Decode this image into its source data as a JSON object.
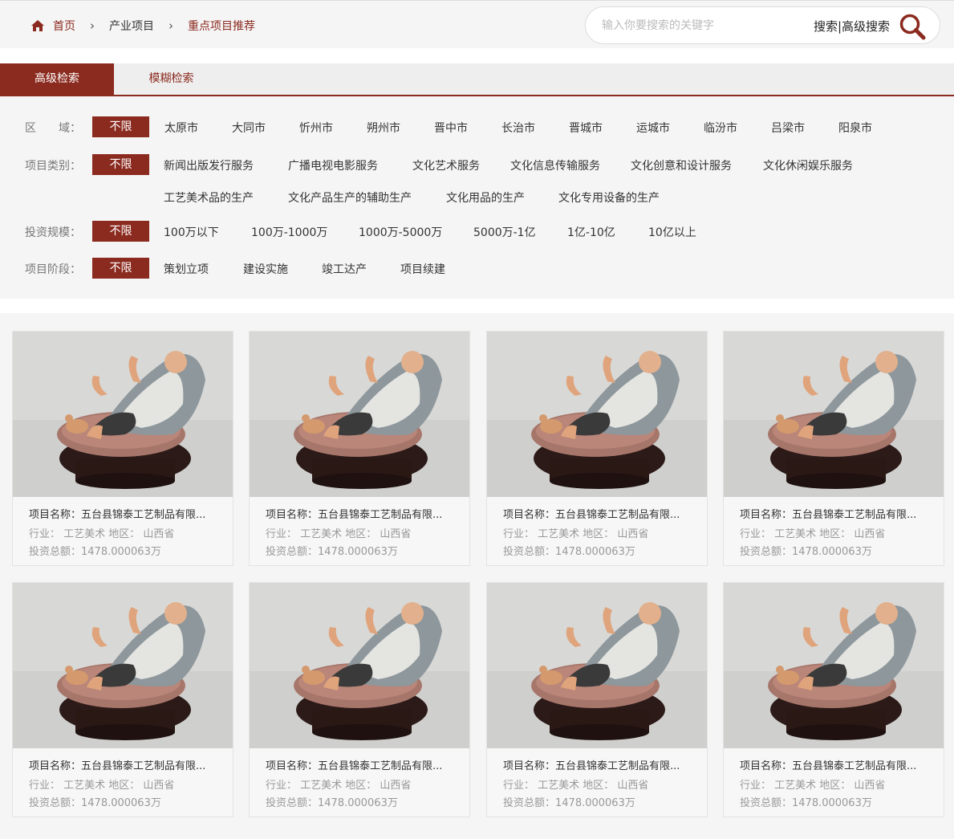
{
  "breadcrumb": {
    "home": "首页",
    "items": [
      "产业项目"
    ],
    "current": "重点项目推荐",
    "separator": "›"
  },
  "search": {
    "placeholder": "输入你要搜索的关键字",
    "link_label": "搜索|高级搜索"
  },
  "tabs": [
    {
      "label": "高级检索",
      "active": true
    },
    {
      "label": "模糊检索",
      "active": false
    }
  ],
  "filters": {
    "region": {
      "label": "区　　域：",
      "all": "不限",
      "options": [
        "太原市",
        "大同市",
        "忻州市",
        "朔州市",
        "晋中市",
        "长治市",
        "晋城市",
        "运城市",
        "临汾市",
        "吕梁市",
        "阳泉市"
      ]
    },
    "category": {
      "label": "项目类别：",
      "all": "不限",
      "options": [
        "新闻出版发行服务",
        "广播电视电影服务",
        "文化艺术服务",
        "文化信息传输服务",
        "文化创意和设计服务",
        "文化休闲娱乐服务",
        "工艺美术品的生产",
        "文化产品生产的辅助生产",
        "文化用品的生产",
        "文化专用设备的生产"
      ]
    },
    "scale": {
      "label": "投资规模：",
      "all": "不限",
      "options": [
        "100万以下",
        "100万-1000万",
        "1000万-5000万",
        "5000万-1亿",
        "1亿-10亿",
        "10亿以上"
      ]
    },
    "stage": {
      "label": "项目阶段：",
      "all": "不限",
      "options": [
        "策划立项",
        "建设实施",
        "竣工达产",
        "项目续建"
      ]
    }
  },
  "projects": [
    {
      "name": "项目名称：五台县锦泰工艺制品有限...",
      "meta": "行业： 工艺美术 地区： 山西省",
      "investment": "投资总额：1478.000063万"
    },
    {
      "name": "项目名称：五台县锦泰工艺制品有限...",
      "meta": "行业： 工艺美术 地区： 山西省",
      "investment": "投资总额：1478.000063万"
    },
    {
      "name": "项目名称：五台县锦泰工艺制品有限...",
      "meta": "行业： 工艺美术 地区： 山西省",
      "investment": "投资总额：1478.000063万"
    },
    {
      "name": "项目名称：五台县锦泰工艺制品有限...",
      "meta": "行业： 工艺美术 地区： 山西省",
      "investment": "投资总额：1478.000063万"
    },
    {
      "name": "项目名称：五台县锦泰工艺制品有限...",
      "meta": "行业： 工艺美术 地区： 山西省",
      "investment": "投资总额：1478.000063万"
    },
    {
      "name": "项目名称：五台县锦泰工艺制品有限...",
      "meta": "行业： 工艺美术 地区： 山西省",
      "investment": "投资总额：1478.000063万"
    },
    {
      "name": "项目名称：五台县锦泰工艺制品有限...",
      "meta": "行业： 工艺美术 地区： 山西省",
      "investment": "投资总额：1478.000063万"
    },
    {
      "name": "项目名称：五台县锦泰工艺制品有限...",
      "meta": "行业： 工艺美术 地区： 山西省",
      "investment": "投资总额：1478.000063万"
    }
  ],
  "colors": {
    "accent": "#8b2a1f",
    "panel_bg": "#f5f5f5",
    "muted_text": "#999999"
  },
  "icons": {
    "home": "home-icon",
    "search": "search-icon"
  }
}
